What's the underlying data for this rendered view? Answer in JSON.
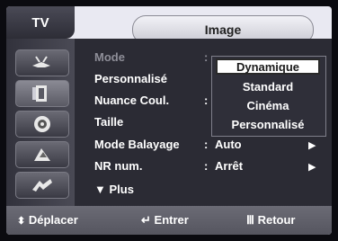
{
  "header": {
    "tab_label": "TV",
    "title": "Image"
  },
  "sidebar": {
    "items": [
      {
        "icon": "antenna-icon"
      },
      {
        "icon": "picture-icon"
      },
      {
        "icon": "sound-icon"
      },
      {
        "icon": "channel-icon"
      },
      {
        "icon": "setup-icon"
      }
    ]
  },
  "menu": {
    "rows": [
      {
        "label": "Mode",
        "colon": ":",
        "value": "",
        "dim": true
      },
      {
        "label": "Personnalisé",
        "colon": "",
        "value": "",
        "dim": false
      },
      {
        "label": "Nuance Coul.",
        "colon": ":",
        "value": "",
        "dim": false
      },
      {
        "label": "Taille",
        "colon": "",
        "value": "",
        "dim": false
      },
      {
        "label": "Mode Balayage",
        "colon": ":",
        "value": "Auto",
        "arrow": "▶",
        "dim": false
      },
      {
        "label": "NR num.",
        "colon": ":",
        "value": "Arrêt",
        "arrow": "▶",
        "dim": false
      },
      {
        "label": "▼ Plus",
        "colon": "",
        "value": "",
        "dim": false
      }
    ]
  },
  "dropdown": {
    "options": [
      "Dynamique",
      "Standard",
      "Cinéma",
      "Personnalisé"
    ],
    "selected": "Dynamique"
  },
  "footer": {
    "move_icon": "up-down-icon",
    "move_label": "Déplacer",
    "enter_icon": "enter-icon",
    "enter_label": "Entrer",
    "return_icon": "menu-icon",
    "return_label": "Retour"
  }
}
